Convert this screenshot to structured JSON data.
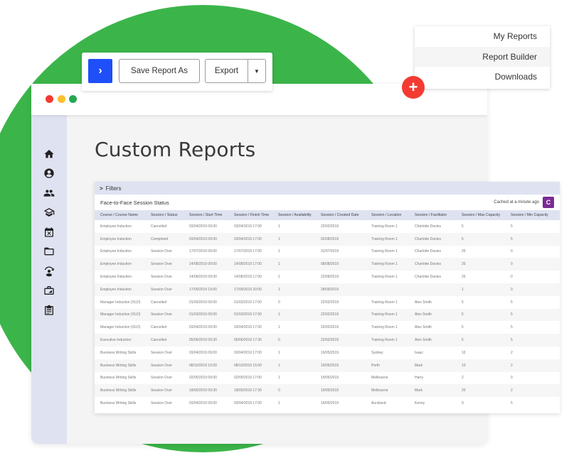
{
  "toolbar": {
    "go_icon": "chevron-right-icon",
    "save_label": "Save Report As",
    "export_label": "Export",
    "export_caret_icon": "caret-down-icon"
  },
  "menu": {
    "items": [
      {
        "label": "My Reports",
        "active": false
      },
      {
        "label": "Report Builder",
        "active": true
      },
      {
        "label": "Downloads",
        "active": false
      }
    ]
  },
  "fab": {
    "icon": "plus-icon",
    "glyph": "+",
    "color": "#f43b32"
  },
  "window": {
    "traffic_lights": [
      "#f43b32",
      "#fbc02d",
      "#25a853"
    ]
  },
  "sidebar": {
    "items": [
      {
        "icon": "home-icon"
      },
      {
        "icon": "user-circle-icon"
      },
      {
        "icon": "group-icon"
      },
      {
        "icon": "graduation-cap-icon"
      },
      {
        "icon": "calendar-x-icon"
      },
      {
        "icon": "folder-icon"
      },
      {
        "icon": "user-sync-icon"
      },
      {
        "icon": "briefcase-icon"
      },
      {
        "icon": "clipboard-icon"
      }
    ]
  },
  "page": {
    "title": "Custom Reports"
  },
  "report": {
    "filters_label": "Filters",
    "name": "Face-to-Face Session Status",
    "cached_text": "Cached at a minute ago",
    "refresh_glyph": "C",
    "accent": "#7b2a94",
    "columns": [
      "Course / Course Name",
      "Session / Status",
      "Session / Start Time",
      "Session / Finish Time",
      "Session / Availability",
      "Session / Created Date",
      "Session / Location",
      "Session / Facilitator",
      "Session / Max Capacity",
      "Session / Min Capacity"
    ],
    "rows": [
      [
        "Employee Induction",
        "Cancelled",
        "03/04/2019 09:00",
        "03/04/2019 17:00",
        "1",
        "22/02/2019",
        "Training Room 1",
        "Charlotte Davies",
        "5",
        "5"
      ],
      [
        "Employee Induction",
        "Completed",
        "03/04/2019 09:00",
        "03/04/2019 17:00",
        "1",
        "02/08/2019",
        "Training Room 1",
        "Charlotte Davies",
        "5",
        "5"
      ],
      [
        "Employee Induction",
        "Session Over",
        "17/07/2019 09:00",
        "17/07/2019 17:00",
        "1",
        "31/07/2019",
        "Training Room 1",
        "Charlotte Davies",
        "25",
        "0"
      ],
      [
        "Employee Induction",
        "Session Over",
        "14/08/2019 09:00",
        "14/08/2019 17:00",
        "1",
        "08/08/2019",
        "Training Room 1",
        "Charlotte Davies",
        "25",
        "0"
      ],
      [
        "Employee Induction",
        "Session Over",
        "14/08/2019 09:00",
        "14/08/2019 17:00",
        "1",
        "22/08/2019",
        "Training Room 1",
        "Charlotte Davies",
        "25",
        "0"
      ],
      [
        "Employee Induction",
        "Session Over",
        "17/09/2019 19:00",
        "17/09/2019 20:00",
        "1",
        "28/09/2019",
        "",
        "",
        "1",
        "0"
      ],
      [
        "Manager Induction (OLD)",
        "Cancelled",
        "01/03/2019 09:00",
        "01/03/2019 17:00",
        "0",
        "22/02/2019",
        "Training Room 1",
        "Alex Smith",
        "5",
        "5"
      ],
      [
        "Manager Induction (OLD)",
        "Session Over",
        "01/03/2019 09:00",
        "01/03/2019 17:00",
        "1",
        "22/02/2019",
        "Training Room 1",
        "Alex Smith",
        "5",
        "5"
      ],
      [
        "Manager Induction (OLD)",
        "Cancelled",
        "03/04/2019 09:00",
        "03/04/2019 17:00",
        "1",
        "22/02/2019",
        "Training Room 1",
        "Alex Smith",
        "5",
        "5"
      ],
      [
        "Executive Induction",
        "Cancelled",
        "05/06/2019 09:30",
        "05/06/2019 17:30",
        "0",
        "22/02/2019",
        "Training Room 1",
        "Alex Smith",
        "5",
        "5"
      ],
      [
        "Business Writing Skills",
        "Session Over",
        "03/04/2019 09:00",
        "03/04/2019 17:00",
        "1",
        "19/05/2019",
        "Sydney",
        "Isaac",
        "10",
        "2"
      ],
      [
        "Business Writing Skills",
        "Session Over",
        "08/10/2019 10:00",
        "08/10/2019 15:00",
        "1",
        "19/05/2019",
        "Perth",
        "Mark",
        "10",
        "2"
      ],
      [
        "Business Writing Skills",
        "Session Over",
        "02/05/2019 09:00",
        "02/05/2019 17:00",
        "1",
        "19/05/2019",
        "Melbourne",
        "Harry",
        "2",
        "0"
      ],
      [
        "Business Writing Skills",
        "Session Over",
        "18/05/2019 09:30",
        "18/05/2019 17:30",
        "0",
        "19/05/2019",
        "Melbourne",
        "Mark",
        "20",
        "2"
      ],
      [
        "Business Writing Skills",
        "Session Over",
        "03/04/2019 09:00",
        "03/04/2019 17:00",
        "1",
        "19/05/2019",
        "Auckland",
        "Kenny",
        "9",
        "5"
      ]
    ]
  }
}
